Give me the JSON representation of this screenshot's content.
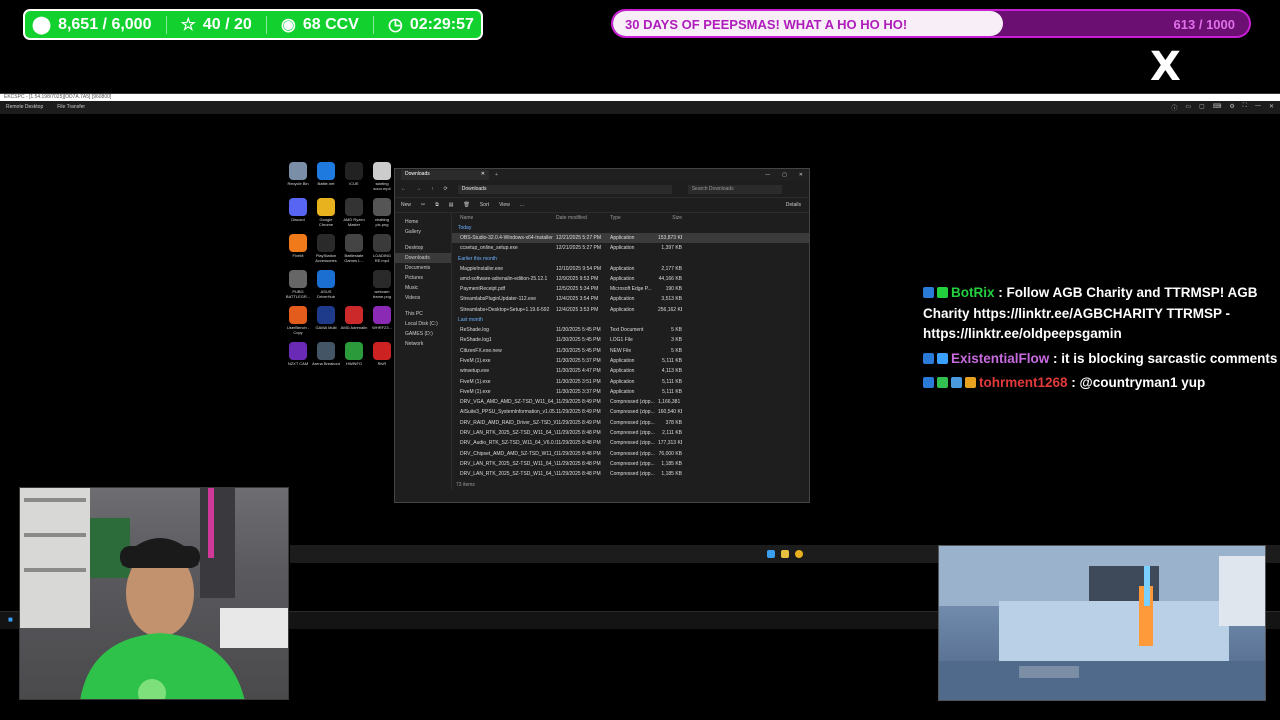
{
  "stream": {
    "stats": [
      {
        "icon": "coin-icon",
        "glyph": "⬤",
        "value": "8,651 / 6,000"
      },
      {
        "icon": "star-icon",
        "glyph": "☆",
        "value": "40 / 20"
      },
      {
        "icon": "eye-icon",
        "glyph": "◉",
        "value": "68 CCV"
      },
      {
        "icon": "clock-icon",
        "glyph": "◷",
        "value": "02:29:57"
      }
    ],
    "goal": {
      "title": "30 DAYS OF PEEPSMAS! WHAT A HO HO HO!",
      "count": "613 / 1000",
      "progress": 0.613
    },
    "social_logo": "X"
  },
  "remote_desktop": {
    "title": "EKCSPC - [1.54.198/7025][OD7A.7A5] [960800]",
    "tabs": [
      "Remote Desktop",
      "File Transfer"
    ]
  },
  "desktop_icons": [
    {
      "label": "Recycle Bin",
      "color": "#7a8ea8"
    },
    {
      "label": "Battle.net",
      "color": "#1f7ae0"
    },
    {
      "label": "iCUE",
      "color": "#222222"
    },
    {
      "label": "starting soon.mp4",
      "color": "#cccccc"
    },
    {
      "label": "Discord",
      "color": "#5865f2"
    },
    {
      "label": "Google Chrome",
      "color": "#e8b21f"
    },
    {
      "label": "AMD Ryzen Master",
      "color": "#333333"
    },
    {
      "label": "chatting pic.png",
      "color": "#555555"
    },
    {
      "label": "FiveM",
      "color": "#f07a1a"
    },
    {
      "label": "PlayStation Accessories",
      "color": "#2a2a2a"
    },
    {
      "label": "Battlestate Games L...",
      "color": "#444444"
    },
    {
      "label": "LOADING RE.mp4",
      "color": "#3a3a3a"
    },
    {
      "label": "PUBG BATTLEGR...",
      "color": "#666666"
    },
    {
      "label": "ASUS DriverHub",
      "color": "#1a6fd0"
    },
    {
      "label": "",
      "color": ""
    },
    {
      "label": "webcam frame.png",
      "color": "#2a2a2a"
    },
    {
      "label": "UserBench - Copy",
      "color": "#e45c1c"
    },
    {
      "label": "GAMA Multi",
      "color": "#1d3b8a"
    },
    {
      "label": "AMD Adrenalin",
      "color": "#cc2a2a"
    },
    {
      "label": "WHRF23...",
      "color": "#8a2ab5"
    },
    {
      "label": "NZXT CAM",
      "color": "#6b2ab5"
    },
    {
      "label": "Arena Breakout",
      "color": "#445566"
    },
    {
      "label": "HWiNFO",
      "color": "#2a9a3a"
    },
    {
      "label": "RivR",
      "color": "#cc2222"
    }
  ],
  "explorer": {
    "tab_title": "Downloads",
    "address": "Downloads",
    "search_placeholder": "Search Downloads",
    "commands": [
      "New",
      "Sort",
      "View",
      "..."
    ],
    "details_label": "Details",
    "sidebar": [
      "Home",
      "Gallery",
      "Desktop",
      "Downloads",
      "Documents",
      "Pictures",
      "Music",
      "Videos",
      "This PC",
      "Local Disk (C:)",
      "GAMES (D:)",
      "Network"
    ],
    "columns": [
      "Name",
      "Date modified",
      "Type",
      "Size"
    ],
    "groups": [
      {
        "label": "Today",
        "rows": [
          {
            "name": "OBS-Studio-32.0.4-Windows-x64-Installer",
            "date": "12/21/2025 5:27 PM",
            "type": "Application",
            "size": "153,873 KB",
            "selected": true
          },
          {
            "name": "ccsetup_online_setup.exe",
            "date": "12/21/2025 5:27 PM",
            "type": "Application",
            "size": "1,397 KB"
          }
        ]
      },
      {
        "label": "Earlier this month",
        "rows": [
          {
            "name": "MagpieInstaller.exe",
            "date": "12/10/2025 9:54 PM",
            "type": "Application",
            "size": "2,177 KB"
          },
          {
            "name": "amd-software-adrenalin-edition-25.12.1",
            "date": "12/9/2025 9:53 PM",
            "type": "Application",
            "size": "44,166 KB"
          },
          {
            "name": "PaymentReceipt.pdf",
            "date": "12/5/2025 5:34 PM",
            "type": "Microsoft Edge P...",
            "size": "190 KB"
          },
          {
            "name": "StreamlabsPluginUpdater-112.exe",
            "date": "12/4/2025 3:54 PM",
            "type": "Application",
            "size": "3,513 KB"
          },
          {
            "name": "Streamlabs+Desktop+Setup+1.19.6-592",
            "date": "12/4/2025 3:53 PM",
            "type": "Application",
            "size": "256,162 KB"
          }
        ]
      },
      {
        "label": "Last month",
        "rows": [
          {
            "name": "ReShade.log",
            "date": "11/30/2025 5:45 PM",
            "type": "Text Document",
            "size": "5 KB"
          },
          {
            "name": "ReShade.log1",
            "date": "11/30/2025 5:45 PM",
            "type": "LOG1 File",
            "size": "3 KB"
          },
          {
            "name": "CitizenFX.exe.new",
            "date": "11/30/2025 5:45 PM",
            "type": "NEW File",
            "size": "5 KB"
          },
          {
            "name": "FiveM (1).exe",
            "date": "11/30/2025 5:37 PM",
            "type": "Application",
            "size": "5,111 KB"
          },
          {
            "name": "winsetup.exe",
            "date": "11/30/2025 4:47 PM",
            "type": "Application",
            "size": "4,113 KB"
          },
          {
            "name": "FiveM (1).exe",
            "date": "11/30/2025 3:51 PM",
            "type": "Application",
            "size": "5,111 KB"
          },
          {
            "name": "FiveM (1).exe",
            "date": "11/30/2025 3:37 PM",
            "type": "Application",
            "size": "5,111 KB"
          },
          {
            "name": "DRV_VGA_AMD_AMD_SZ-TSD_W11_64_V...",
            "date": "11/29/2025 8:49 PM",
            "type": "Compressed (zipp...",
            "size": "1,166,381 KB"
          },
          {
            "name": "AISuite3_PPSU_SystemInformation_v1.05...",
            "date": "11/29/2025 8:49 PM",
            "type": "Compressed (zipp...",
            "size": "160,540 KB"
          },
          {
            "name": "DRV_RAID_AMD_RAID_Driver_SZ-TSD_W...",
            "date": "11/29/2025 8:49 PM",
            "type": "Compressed (zipp...",
            "size": "378 KB"
          },
          {
            "name": "DRV_LAN_RTK_2025_SZ-TSD_W11_64_V1...",
            "date": "11/29/2025 8:48 PM",
            "type": "Compressed (zipp...",
            "size": "2,111 KB"
          },
          {
            "name": "DRV_Audio_RTK_SZ-TSD_W11_64_V6.0.9",
            "date": "11/29/2025 8:48 PM",
            "type": "Compressed (zipp...",
            "size": "177,313 KB"
          },
          {
            "name": "DRV_Chipset_AMD_AMD_SZ-TSD_W11_6...",
            "date": "11/29/2025 8:48 PM",
            "type": "Compressed (zipp...",
            "size": "76,000 KB"
          },
          {
            "name": "DRV_LAN_RTK_2025_SZ-TSD_W11_64_V1...",
            "date": "11/29/2025 8:48 PM",
            "type": "Compressed (zipp...",
            "size": "1,185 KB"
          },
          {
            "name": "DRV_LAN_RTK_2025_SZ-TSD_W11_64_V1...",
            "date": "11/29/2025 8:48 PM",
            "type": "Compressed (zipp...",
            "size": "1,185 KB"
          }
        ]
      }
    ],
    "status": "73 items"
  },
  "chat": [
    {
      "user": "BotRix",
      "user_color": "#23d13f",
      "badges": [
        "#2a7ad8",
        "#23d13f"
      ],
      "message": ": Follow AGB Charity and TTRMSP! AGB Charity https://linktr.ee/AGBCHARITY TTRMSP - https://linktr.ee/oldpeepsgamin"
    },
    {
      "user": "ExistentialFlow",
      "user_color": "#c86be0",
      "badges": [
        "#2a7ad8",
        "#3aa0ff"
      ],
      "message": ": it is blocking sarcastic comments"
    },
    {
      "user": "tohrment1268",
      "user_color": "#e23a3a",
      "badges": [
        "#2a7ad8",
        "#32c050",
        "#4a9ae0",
        "#e8a020"
      ],
      "message": ": @countryman1 yup"
    }
  ]
}
